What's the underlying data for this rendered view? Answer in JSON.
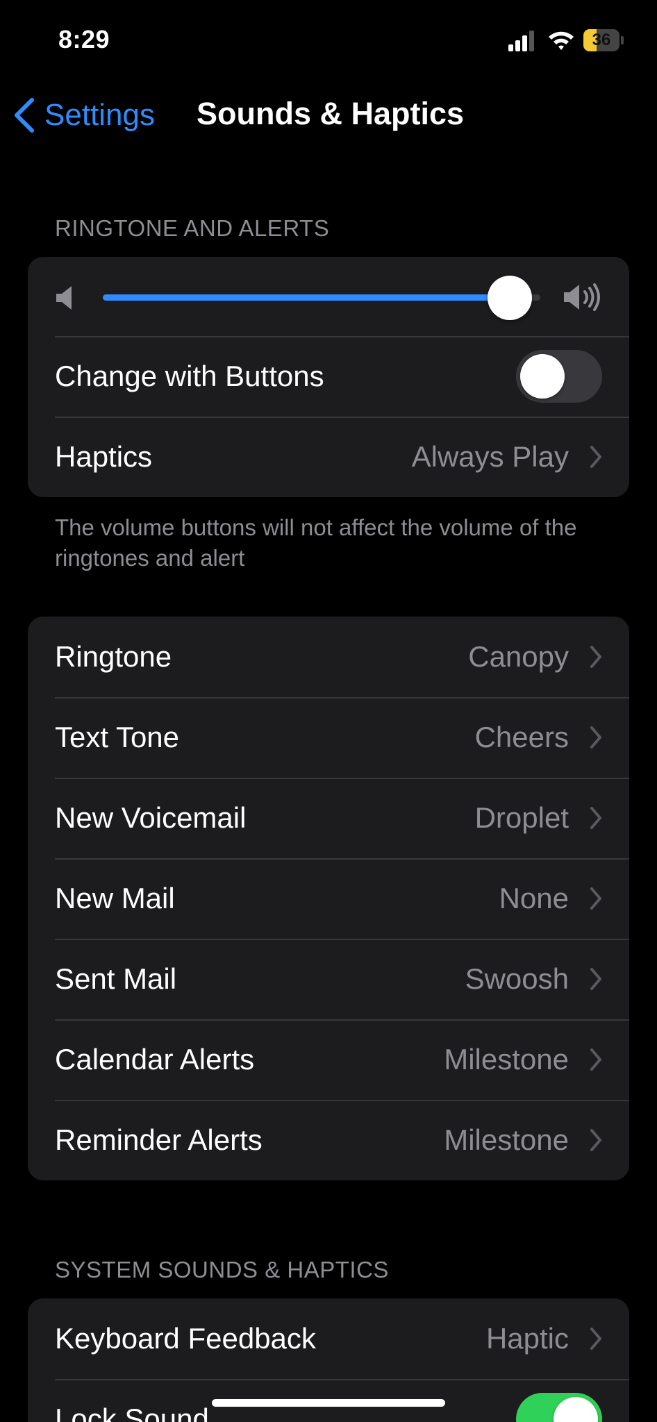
{
  "status_bar": {
    "time": "8:29",
    "battery_level": "36",
    "signal_icon": "cellular-signal-icon",
    "wifi_icon": "wifi-icon",
    "battery_icon": "battery-icon",
    "battery_color": "#f5c932"
  },
  "nav": {
    "back_label": "Settings",
    "title": "Sounds & Haptics",
    "back_icon": "chevron-left-icon",
    "accent": "#2f8cff"
  },
  "ringtone_alerts": {
    "header": "RINGTONE AND ALERTS",
    "volume_level": 0.93,
    "volume_low_icon": "speaker-low-icon",
    "volume_high_icon": "speaker-high-icon",
    "change_with_buttons": {
      "label": "Change with Buttons",
      "on": false
    },
    "haptics": {
      "label": "Haptics",
      "value": "Always Play"
    },
    "footer": "The volume buttons will not affect the volume of the ringtones and alert"
  },
  "tones": [
    {
      "label": "Ringtone",
      "value": "Canopy"
    },
    {
      "label": "Text Tone",
      "value": "Cheers"
    },
    {
      "label": "New Voicemail",
      "value": "Droplet"
    },
    {
      "label": "New Mail",
      "value": "None"
    },
    {
      "label": "Sent Mail",
      "value": "Swoosh"
    },
    {
      "label": "Calendar Alerts",
      "value": "Milestone"
    },
    {
      "label": "Reminder Alerts",
      "value": "Milestone"
    }
  ],
  "system": {
    "header": "SYSTEM SOUNDS & HAPTICS",
    "keyboard_feedback": {
      "label": "Keyboard Feedback",
      "value": "Haptic"
    },
    "lock_sound": {
      "label": "Lock Sound",
      "on": true
    }
  },
  "colors": {
    "toggle_on": "#30d158",
    "card_bg": "#1c1c1e",
    "secondary_text": "#8d8d93"
  }
}
